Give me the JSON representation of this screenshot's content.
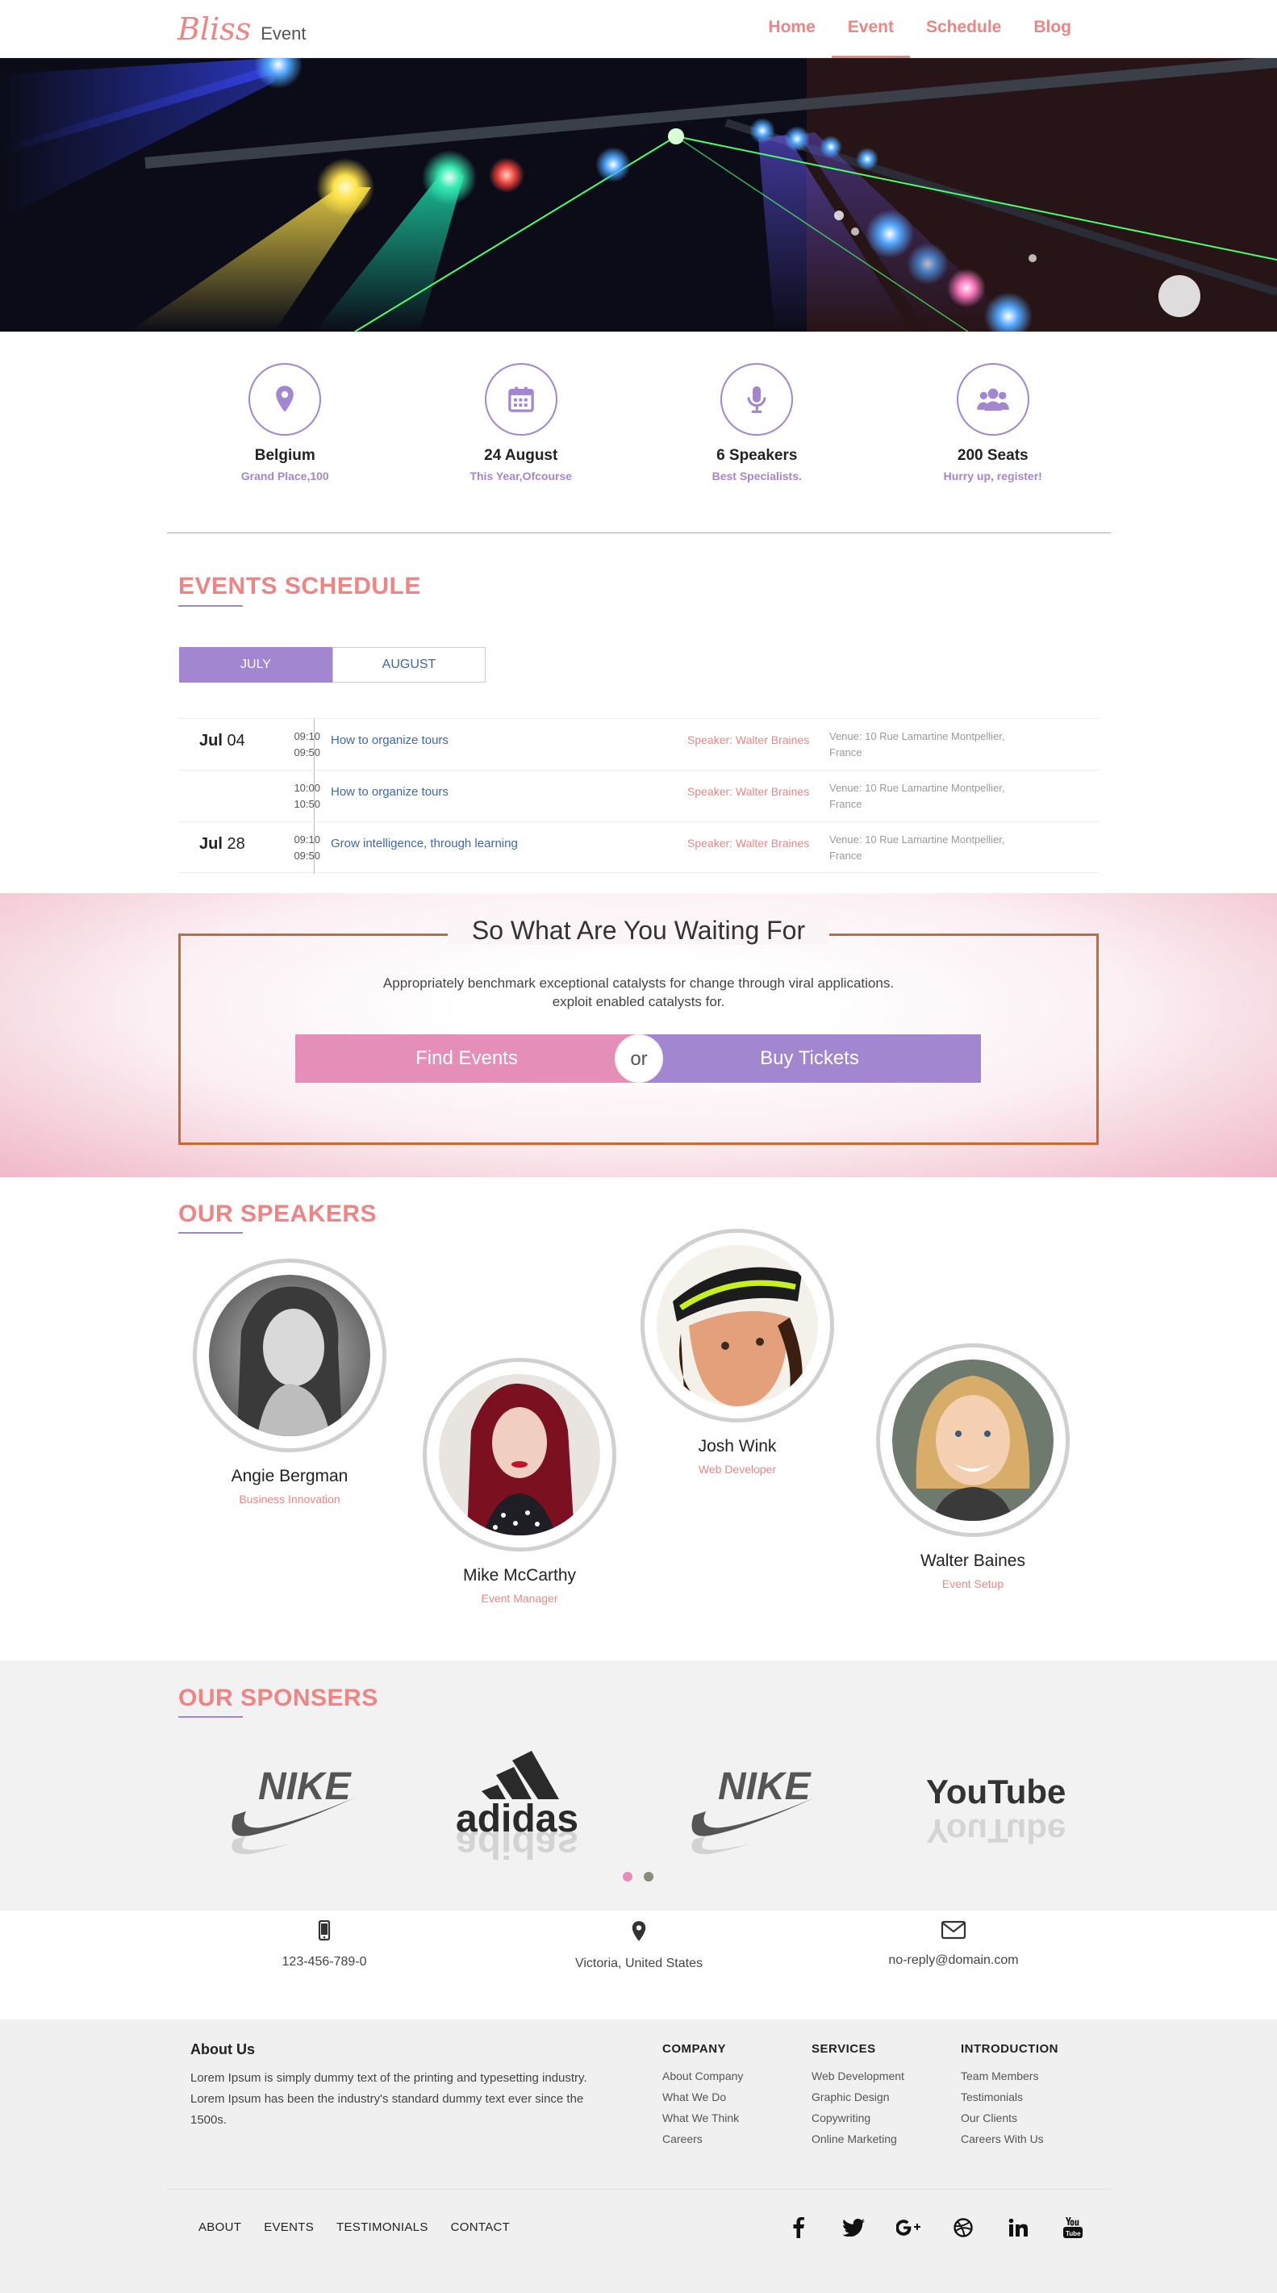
{
  "header": {
    "logo_script": "Bliss",
    "logo_word": "Event",
    "nav": [
      {
        "label": "Home",
        "active": false
      },
      {
        "label": "Event",
        "active": true
      },
      {
        "label": "Schedule",
        "active": false
      },
      {
        "label": "Blog",
        "active": false
      }
    ]
  },
  "info": [
    {
      "icon": "map-pin-icon",
      "title": "Belgium",
      "sub": "Grand Place,100"
    },
    {
      "icon": "calendar-icon",
      "title": "24 August",
      "sub": "This Year,Ofcourse"
    },
    {
      "icon": "microphone-icon",
      "title": "6 Speakers",
      "sub": "Best Specialists."
    },
    {
      "icon": "users-icon",
      "title": "200 Seats",
      "sub": "Hurry up, register!"
    }
  ],
  "schedule": {
    "heading": "EVENTS SCHEDULE",
    "tabs": [
      {
        "label": "JULY",
        "active": true
      },
      {
        "label": "AUGUST",
        "active": false
      }
    ],
    "rows": [
      {
        "month": "Jul",
        "day": "04",
        "start": "09:10",
        "end": "09:50",
        "title": "How to organize tours",
        "speaker": "Speaker: Walter Braines",
        "venue": "Venue: 10 Rue Lamartine Montpellier, France"
      },
      {
        "month": "",
        "day": "",
        "start": "10:00",
        "end": "10:50",
        "title": "How to organize tours",
        "speaker": "Speaker: Walter Braines",
        "venue": "Venue: 10 Rue Lamartine Montpellier, France"
      },
      {
        "month": "Jul",
        "day": "28",
        "start": "09:10",
        "end": "09:50",
        "title": "Grow intelligence, through learning",
        "speaker": "Speaker: Walter Braines",
        "venue": "Venue: 10 Rue Lamartine Montpellier, France"
      }
    ]
  },
  "cta": {
    "title": "So What Are You Waiting For",
    "line1": "Appropriately benchmark exceptional catalysts for change through viral applications.",
    "line2": "exploit enabled catalysts for.",
    "find_label": "Find Events",
    "or_label": "or",
    "buy_label": "Buy Tickets"
  },
  "speakers": {
    "heading": "OUR SPEAKERS",
    "items": [
      {
        "name": "Angie Bergman",
        "role": "Business Innovation"
      },
      {
        "name": "Mike McCarthy",
        "role": "Event Manager"
      },
      {
        "name": "Josh Wink",
        "role": "Web Developer"
      },
      {
        "name": "Walter Baines",
        "role": "Event Setup"
      }
    ]
  },
  "sponsors": {
    "heading": "OUR SPONSERS",
    "logos": [
      {
        "text": "NIKE",
        "icon": "nike-logo"
      },
      {
        "text": "adidas",
        "icon": "adidas-logo"
      },
      {
        "text": "NIKE",
        "icon": "nike-logo"
      },
      {
        "text": "YouTube",
        "icon": "youtube-logo"
      }
    ]
  },
  "contact": {
    "phone": "123-456-789-0",
    "location": "Victoria, United States",
    "email": "no-reply@domain.com"
  },
  "footer": {
    "about_heading": "About Us",
    "about_text": "Lorem Ipsum is simply dummy text of the printing and typesetting industry. Lorem Ipsum has been the industry's standard dummy text ever since the 1500s.",
    "columns": [
      {
        "heading": "COMPANY",
        "items": [
          "About Company",
          "What We Do",
          "What We Think",
          "Careers"
        ]
      },
      {
        "heading": "SERVICES",
        "items": [
          "Web Development",
          "Graphic Design",
          "Copywriting",
          "Online Marketing"
        ]
      },
      {
        "heading": "INTRODUCTION",
        "items": [
          "Team Members",
          "Testimonials",
          "Our Clients",
          "Careers With Us"
        ]
      }
    ],
    "links": [
      "ABOUT",
      "EVENTS",
      "TESTIMONIALS",
      "CONTACT"
    ],
    "social": [
      "facebook-icon",
      "twitter-icon",
      "google-plus-icon",
      "dribbble-icon",
      "linkedin-icon",
      "youtube-icon"
    ]
  },
  "colors": {
    "accent_pink": "#ee8585",
    "accent_purple": "#a286d0",
    "button_pink": "#e58fb8",
    "cta_border": "#c96a36",
    "link_blue": "#3b69a8"
  }
}
